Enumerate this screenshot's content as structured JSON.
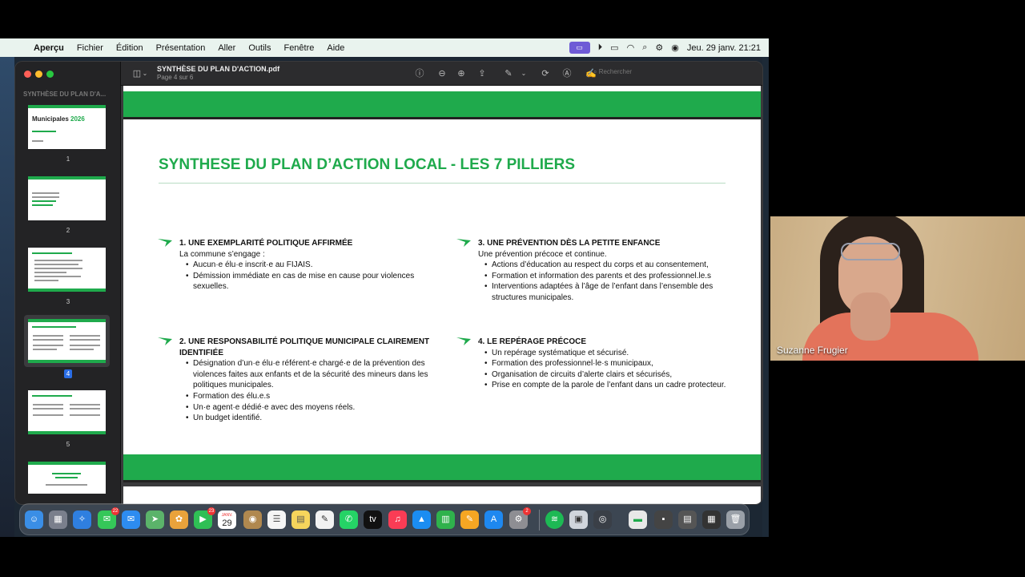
{
  "menubar": {
    "app": "Aperçu",
    "items": [
      "Fichier",
      "Édition",
      "Présentation",
      "Aller",
      "Outils",
      "Fenêtre",
      "Aide"
    ],
    "clock": "Jeu. 29 janv. 21:21"
  },
  "sidebar": {
    "title": "SYNTHÈSE DU PLAN D'A...",
    "pages": [
      "1",
      "2",
      "3",
      "4",
      "5"
    ],
    "selected_page": "4",
    "thumb1_title": "Municipales",
    "thumb1_year": "2026"
  },
  "toolbar": {
    "doc_title": "SYNTHÈSE DU PLAN D'ACTION.pdf",
    "page_info": "Page 4 sur 6",
    "search_placeholder": "Rechercher"
  },
  "slide": {
    "title": "SYNTHESE DU PLAN D’ACTION LOCAL - LES 7 PILLIERS",
    "pillars": [
      {
        "heading": "1. UNE EXEMPLARITÉ POLITIQUE AFFIRMÉE",
        "intro": "La commune s’engage :",
        "bullets": [
          "Aucun·e élu·e inscrit·e au FIJAIS.",
          "Démission immédiate en cas de mise en cause pour violences sexuelles."
        ]
      },
      {
        "heading": "2. UNE RESPONSABILITÉ POLITIQUE MUNICIPALE CLAIREMENT IDENTIFIÉE",
        "intro": "",
        "bullets": [
          "Désignation d’un·e élu·e référent·e chargé·e de la prévention des violences faites aux enfants et de la sécurité des mineurs dans les politiques municipales.",
          "Formation des élu.e.s",
          "Un·e agent·e dédié·e avec des moyens réels.",
          "Un budget identifié."
        ]
      },
      {
        "heading": "3. UNE PRÉVENTION DÈS LA PETITE ENFANCE",
        "intro": "Une prévention précoce et continue.",
        "bullets": [
          "Actions d’éducation au respect du corps et au consentement,",
          "Formation et information des parents et des professionnel.le.s",
          "Interventions adaptées à l’âge de l’enfant dans l’ensemble des structures municipales."
        ]
      },
      {
        "heading": "4. LE REPÉRAGE PRÉCOCE",
        "intro": "",
        "bullets": [
          "Un repérage systématique et sécurisé.",
          "Formation des professionnel·le·s municipaux,",
          "Organisation de circuits d’alerte clairs et sécurisés,",
          "Prise en compte de la parole de l’enfant dans un cadre protecteur."
        ]
      }
    ]
  },
  "dock": {
    "badge_messages": "22",
    "badge_facetime": "23",
    "calendar_month": "JANV.",
    "calendar_day": "29",
    "badge_settings": "2"
  },
  "webcam": {
    "participant_name": "Suzanne Frugier"
  },
  "colors": {
    "green": "#1faa4c",
    "menubar_bg": "#e9f3ee",
    "window_bg": "#2a2a2c"
  }
}
